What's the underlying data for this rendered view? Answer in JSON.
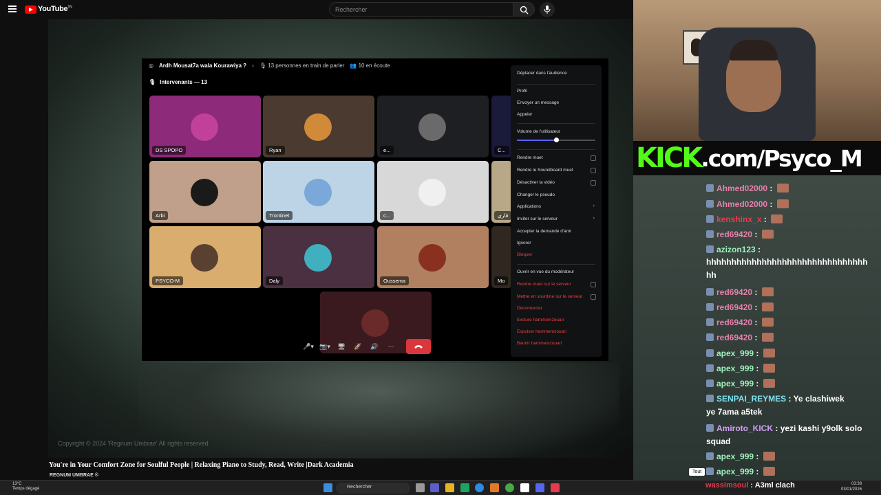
{
  "youtube": {
    "logo_text": "YouTube",
    "logo_sup": "TN",
    "search_placeholder": "Rechercher",
    "copyright": "Copyright © 2024 'Regnum Umbrae' All rights reserved",
    "video_title": "You're in Your Comfort Zone for Soulful People | Relaxing Piano to Study, Read, Write |Dark Academia",
    "channel": "REGNUM UMBRAE ®"
  },
  "discord": {
    "channel_title": "Ardh Mousat7a wala Kourawiya ?",
    "talking": "13 personnes en train de parler",
    "listening": "10 en écoute",
    "speakers_label": "Intervenants — 13",
    "tiles": [
      {
        "label": "DS SPOPO",
        "bg": "#8e2a7a",
        "av": "#c0409a"
      },
      {
        "label": "Ryan",
        "bg": "#4a3a30",
        "av": "#d08a3a"
      },
      {
        "label": "e...",
        "bg": "#1e1f22",
        "av": "#6a6a6a"
      },
      {
        "label": "C...",
        "bg": "#1a1a3a",
        "av": "#333"
      },
      {
        "label": "Arbi",
        "bg": "#c0a08a",
        "av": "#1a1a1a"
      },
      {
        "label": "Trontinet",
        "bg": "#bcd4e6",
        "av": "#7aa8d8"
      },
      {
        "label": "c...",
        "bg": "#d8d8d8",
        "av": "#f0f0f0"
      },
      {
        "label": "ڤاري",
        "bg": "#b8a888",
        "av": "#888"
      },
      {
        "label": "PSYCO-M",
        "bg": "#d9ad6e",
        "av": "#5a4030"
      },
      {
        "label": "Daly",
        "bg": "#4a3040",
        "av": "#40b0c0"
      },
      {
        "label": "Oussema",
        "bg": "#b08060",
        "av": "#8a3020"
      },
      {
        "label": "Mo",
        "bg": "#302820",
        "av": "#555"
      },
      {
        "label": "",
        "bg": "#3a1a1e",
        "av": "#6a2a2a"
      }
    ]
  },
  "context_menu": {
    "move_audience": "Déplacer dans l'audience",
    "profile": "Profil",
    "send_message": "Envoyer un message",
    "call": "Appeler",
    "volume_label": "Volume de l'utilisateur",
    "volume_level": 0.5,
    "mute": "Rendre muet",
    "mute_soundboard": "Rendre le Soundboard muet",
    "disable_video": "Désactiver la vidéo",
    "change_nick": "Changer le pseudo",
    "apps": "Applications",
    "invite": "Inviter sur le serveur",
    "accept_friend": "Accepter la demande d'ami",
    "ignore": "Ignorer",
    "block": "Bloquer",
    "mod_view": "Ouvrir en vue du modérateur",
    "server_mute": "Rendre muet sur le serveur",
    "server_deafen": "Mettre en sourdine sur le serveur",
    "disconnect": "Déconnecter",
    "timeout": "Exclure hammemzouari",
    "kick": "Expulser hammemzouari",
    "ban": "Bannir hammemzouari"
  },
  "kick": {
    "logo": "KICK",
    "url": ".com/Psyco_M"
  },
  "chat": [
    {
      "user": "Ahmed02000",
      "cls": "u-pink",
      "emote": true,
      "msg": ""
    },
    {
      "user": "Ahmed02000",
      "cls": "u-pink",
      "emote": true,
      "msg": ""
    },
    {
      "user": "kenshinx_x",
      "cls": "u-red",
      "emote": true,
      "msg": ""
    },
    {
      "user": "red69420",
      "cls": "u-pink",
      "emote": true,
      "msg": ""
    },
    {
      "user": "azizon123",
      "cls": "u-green",
      "emote": false,
      "msg": ""
    },
    {
      "user": "",
      "cls": "msg",
      "emote": false,
      "msg": "hhhhhhhhhhhhhhhhhhhhhhhhhhhhhhhh"
    },
    {
      "user": "",
      "cls": "msg",
      "emote": false,
      "msg": "hh"
    },
    {
      "user": "red69420",
      "cls": "u-pink",
      "emote": true,
      "msg": ""
    },
    {
      "user": "red69420",
      "cls": "u-pink",
      "emote": true,
      "msg": ""
    },
    {
      "user": "red69420",
      "cls": "u-pink",
      "emote": true,
      "msg": ""
    },
    {
      "user": "red69420",
      "cls": "u-pink",
      "emote": true,
      "msg": ""
    },
    {
      "user": "apex_999",
      "cls": "u-green",
      "emote": true,
      "msg": ""
    },
    {
      "user": "apex_999",
      "cls": "u-green",
      "emote": true,
      "msg": ""
    },
    {
      "user": "apex_999",
      "cls": "u-green",
      "emote": true,
      "msg": ""
    },
    {
      "user": "SENPAI_REYMES",
      "cls": "u-cyan",
      "emote": false,
      "msg": "Ye clashiwek"
    },
    {
      "user": "",
      "cls": "msg",
      "emote": false,
      "msg": "ye 7ama a5tek"
    },
    {
      "user": "Amiroto_KICK",
      "cls": "u-purple",
      "emote": false,
      "msg": "yezi kashi y9olk solo"
    },
    {
      "user": "",
      "cls": "msg",
      "emote": false,
      "msg": "squad"
    },
    {
      "user": "apex_999",
      "cls": "u-green",
      "emote": true,
      "msg": ""
    },
    {
      "user": "apex_999",
      "cls": "u-green",
      "emote": true,
      "msg": ""
    }
  ],
  "bottom": {
    "tout": "Tout",
    "wassim_user": "wassimsoul",
    "wassim_msg": "A3ml clach"
  },
  "taskbar": {
    "temp": "13°C",
    "weather": "Temps dégagé",
    "search": "Rechercher",
    "time": "03:38",
    "date": "03/01/2026"
  }
}
